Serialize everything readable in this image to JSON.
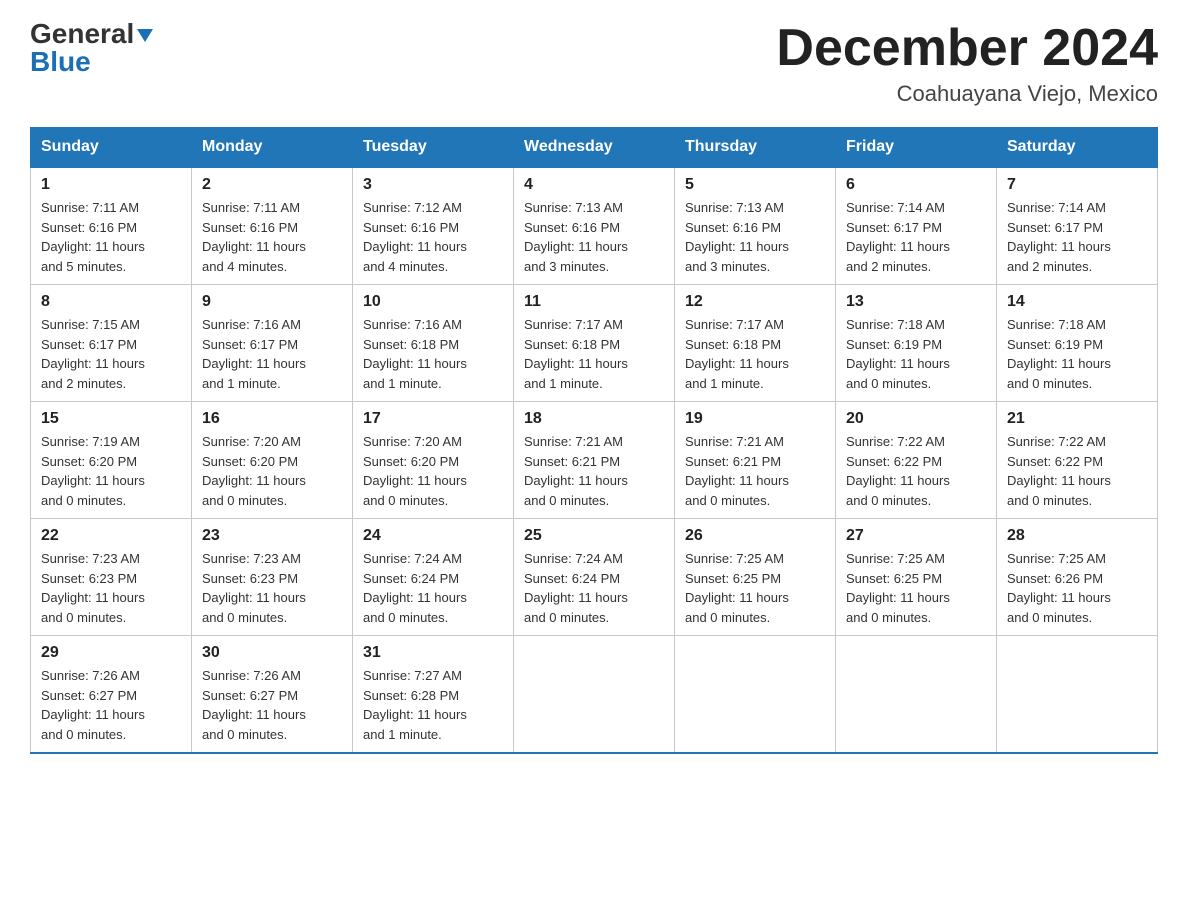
{
  "logo": {
    "text_general": "General",
    "text_blue": "Blue"
  },
  "title": "December 2024",
  "location": "Coahuayana Viejo, Mexico",
  "days_of_week": [
    "Sunday",
    "Monday",
    "Tuesday",
    "Wednesday",
    "Thursday",
    "Friday",
    "Saturday"
  ],
  "weeks": [
    [
      {
        "day": "1",
        "sunrise": "7:11 AM",
        "sunset": "6:16 PM",
        "daylight": "11 hours and 5 minutes."
      },
      {
        "day": "2",
        "sunrise": "7:11 AM",
        "sunset": "6:16 PM",
        "daylight": "11 hours and 4 minutes."
      },
      {
        "day": "3",
        "sunrise": "7:12 AM",
        "sunset": "6:16 PM",
        "daylight": "11 hours and 4 minutes."
      },
      {
        "day": "4",
        "sunrise": "7:13 AM",
        "sunset": "6:16 PM",
        "daylight": "11 hours and 3 minutes."
      },
      {
        "day": "5",
        "sunrise": "7:13 AM",
        "sunset": "6:16 PM",
        "daylight": "11 hours and 3 minutes."
      },
      {
        "day": "6",
        "sunrise": "7:14 AM",
        "sunset": "6:17 PM",
        "daylight": "11 hours and 2 minutes."
      },
      {
        "day": "7",
        "sunrise": "7:14 AM",
        "sunset": "6:17 PM",
        "daylight": "11 hours and 2 minutes."
      }
    ],
    [
      {
        "day": "8",
        "sunrise": "7:15 AM",
        "sunset": "6:17 PM",
        "daylight": "11 hours and 2 minutes."
      },
      {
        "day": "9",
        "sunrise": "7:16 AM",
        "sunset": "6:17 PM",
        "daylight": "11 hours and 1 minute."
      },
      {
        "day": "10",
        "sunrise": "7:16 AM",
        "sunset": "6:18 PM",
        "daylight": "11 hours and 1 minute."
      },
      {
        "day": "11",
        "sunrise": "7:17 AM",
        "sunset": "6:18 PM",
        "daylight": "11 hours and 1 minute."
      },
      {
        "day": "12",
        "sunrise": "7:17 AM",
        "sunset": "6:18 PM",
        "daylight": "11 hours and 1 minute."
      },
      {
        "day": "13",
        "sunrise": "7:18 AM",
        "sunset": "6:19 PM",
        "daylight": "11 hours and 0 minutes."
      },
      {
        "day": "14",
        "sunrise": "7:18 AM",
        "sunset": "6:19 PM",
        "daylight": "11 hours and 0 minutes."
      }
    ],
    [
      {
        "day": "15",
        "sunrise": "7:19 AM",
        "sunset": "6:20 PM",
        "daylight": "11 hours and 0 minutes."
      },
      {
        "day": "16",
        "sunrise": "7:20 AM",
        "sunset": "6:20 PM",
        "daylight": "11 hours and 0 minutes."
      },
      {
        "day": "17",
        "sunrise": "7:20 AM",
        "sunset": "6:20 PM",
        "daylight": "11 hours and 0 minutes."
      },
      {
        "day": "18",
        "sunrise": "7:21 AM",
        "sunset": "6:21 PM",
        "daylight": "11 hours and 0 minutes."
      },
      {
        "day": "19",
        "sunrise": "7:21 AM",
        "sunset": "6:21 PM",
        "daylight": "11 hours and 0 minutes."
      },
      {
        "day": "20",
        "sunrise": "7:22 AM",
        "sunset": "6:22 PM",
        "daylight": "11 hours and 0 minutes."
      },
      {
        "day": "21",
        "sunrise": "7:22 AM",
        "sunset": "6:22 PM",
        "daylight": "11 hours and 0 minutes."
      }
    ],
    [
      {
        "day": "22",
        "sunrise": "7:23 AM",
        "sunset": "6:23 PM",
        "daylight": "11 hours and 0 minutes."
      },
      {
        "day": "23",
        "sunrise": "7:23 AM",
        "sunset": "6:23 PM",
        "daylight": "11 hours and 0 minutes."
      },
      {
        "day": "24",
        "sunrise": "7:24 AM",
        "sunset": "6:24 PM",
        "daylight": "11 hours and 0 minutes."
      },
      {
        "day": "25",
        "sunrise": "7:24 AM",
        "sunset": "6:24 PM",
        "daylight": "11 hours and 0 minutes."
      },
      {
        "day": "26",
        "sunrise": "7:25 AM",
        "sunset": "6:25 PM",
        "daylight": "11 hours and 0 minutes."
      },
      {
        "day": "27",
        "sunrise": "7:25 AM",
        "sunset": "6:25 PM",
        "daylight": "11 hours and 0 minutes."
      },
      {
        "day": "28",
        "sunrise": "7:25 AM",
        "sunset": "6:26 PM",
        "daylight": "11 hours and 0 minutes."
      }
    ],
    [
      {
        "day": "29",
        "sunrise": "7:26 AM",
        "sunset": "6:27 PM",
        "daylight": "11 hours and 0 minutes."
      },
      {
        "day": "30",
        "sunrise": "7:26 AM",
        "sunset": "6:27 PM",
        "daylight": "11 hours and 0 minutes."
      },
      {
        "day": "31",
        "sunrise": "7:27 AM",
        "sunset": "6:28 PM",
        "daylight": "11 hours and 1 minute."
      },
      null,
      null,
      null,
      null
    ]
  ],
  "labels": {
    "sunrise": "Sunrise:",
    "sunset": "Sunset:",
    "daylight": "Daylight:"
  }
}
